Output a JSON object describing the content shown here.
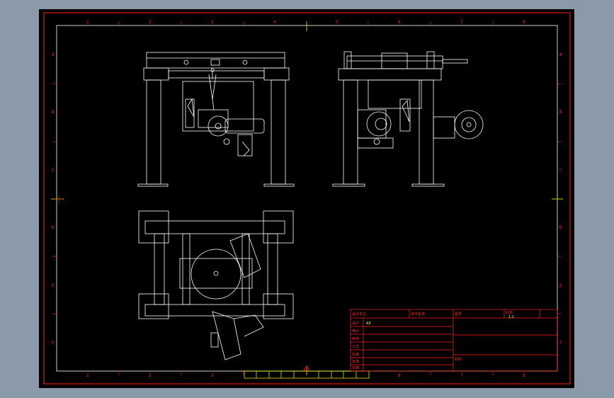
{
  "colors": {
    "background": "#8a9aab",
    "sheet": "#000000",
    "border": "#ff2020",
    "lines": "#ffffff",
    "title_text": "#ff3030",
    "value_text": "#ffff00",
    "marker": "#ffff00"
  },
  "zones": {
    "columns": [
      "1",
      "2",
      "3",
      "4",
      "5",
      "6",
      "7",
      "8"
    ],
    "rows": [
      "A",
      "B",
      "C",
      "D",
      "E",
      "F"
    ]
  },
  "title_block": {
    "header_1": "设计单位",
    "header_2": "零件名称",
    "header_3": "图号",
    "header_4": "比例",
    "scale_value": "1:1",
    "paper_value": "A3",
    "material_label": "材料",
    "rows": [
      "设计",
      "校对",
      "审核",
      "工艺",
      "标准",
      "批准",
      "日期"
    ]
  }
}
